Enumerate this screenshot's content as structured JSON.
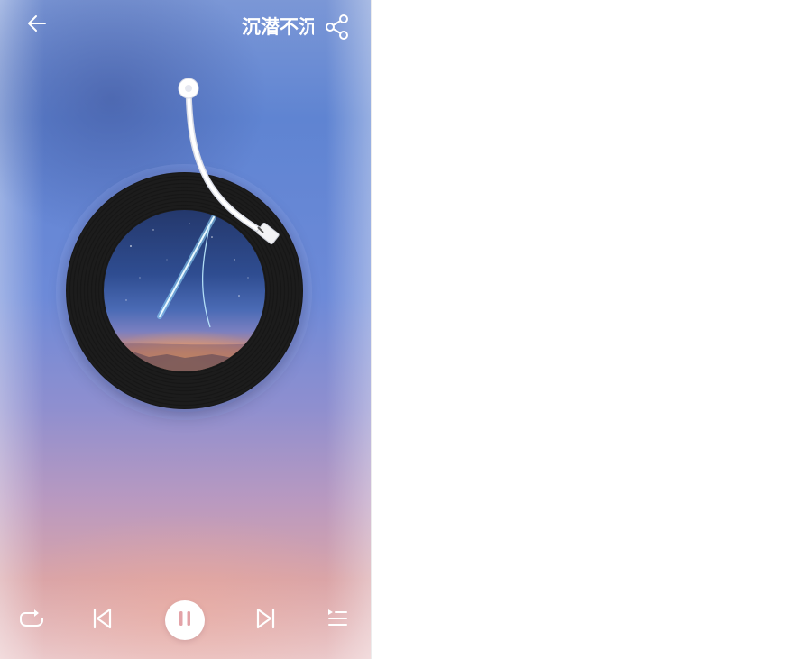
{
  "header": {
    "back_icon": "arrow-left-icon",
    "title": "沉潜不沉",
    "share_icon": "share-icon"
  },
  "player": {
    "cover_art": "night-sky-comet-artwork",
    "state": "playing"
  },
  "controls": {
    "repeat_icon": "repeat-icon",
    "prev_icon": "skip-previous-icon",
    "pause_icon": "pause-icon",
    "next_icon": "skip-next-icon",
    "playlist_icon": "playlist-icon"
  },
  "colors": {
    "background_top": "#6b8ad6",
    "background_bottom": "#ebc9cb",
    "record": "#1c1c1c",
    "icon": "#ffffff",
    "pause_glyph": "#e3a3a8"
  }
}
